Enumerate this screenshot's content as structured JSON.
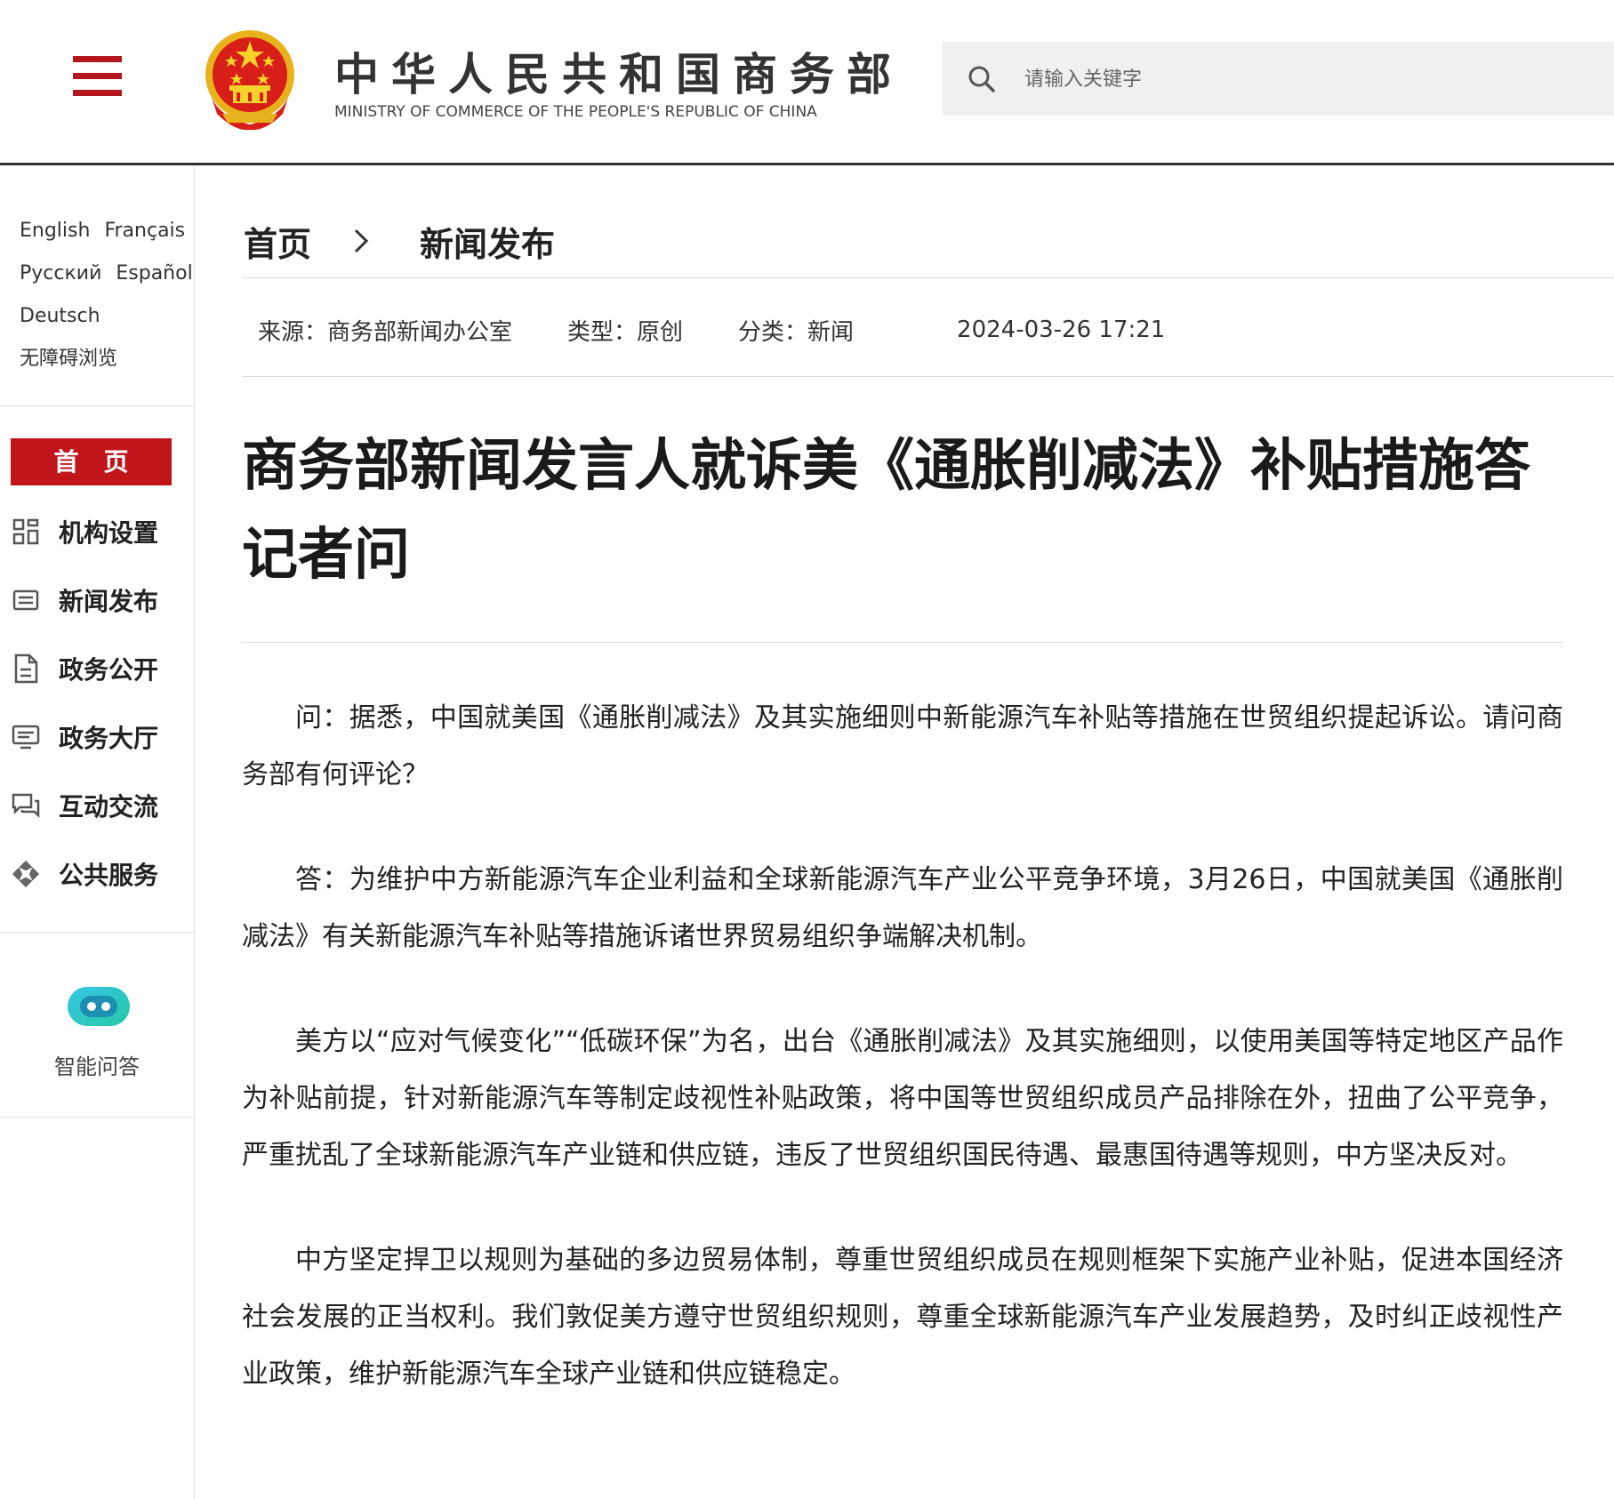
{
  "header": {
    "site_title": "中华人民共和国商务部",
    "site_subtitle": "MINISTRY OF COMMERCE OF THE PEOPLE'S REPUBLIC OF CHINA",
    "search_placeholder": "请输入关键字",
    "accent_color": "#c0151b"
  },
  "sidebar": {
    "languages": [
      "English",
      "Français",
      "Русский",
      "Español",
      "Deutsch"
    ],
    "accessibility": "无障碍浏览",
    "home_label": "首页",
    "nav_items": [
      {
        "label": "机构设置",
        "icon": "grid-icon"
      },
      {
        "label": "新闻发布",
        "icon": "news-icon"
      },
      {
        "label": "政务公开",
        "icon": "document-icon"
      },
      {
        "label": "政务大厅",
        "icon": "monitor-icon"
      },
      {
        "label": "互动交流",
        "icon": "chat-icon"
      },
      {
        "label": "公共服务",
        "icon": "service-icon"
      }
    ],
    "ai_label": "智能问答"
  },
  "breadcrumb": {
    "home": "首页",
    "current": "新闻发布"
  },
  "meta": {
    "source": "来源：商务部新闻办公室",
    "type": "类型：原创",
    "category": "分类：新闻",
    "datetime": "2024-03-26 17:21"
  },
  "article": {
    "title": "商务部新闻发言人就诉美《通胀削减法》补贴措施答记者问",
    "paragraphs": [
      "问：据悉，中国就美国《通胀削减法》及其实施细则中新能源汽车补贴等措施在世贸组织提起诉讼。请问商务部有何评论？",
      "答：为维护中方新能源汽车企业利益和全球新能源汽车产业公平竞争环境，3月26日，中国就美国《通胀削减法》有关新能源汽车补贴等措施诉诸世界贸易组织争端解决机制。",
      "美方以“应对气候变化”“低碳环保”为名，出台《通胀削减法》及其实施细则，以使用美国等特定地区产品作为补贴前提，针对新能源汽车等制定歧视性补贴政策，将中国等世贸组织成员产品排除在外，扭曲了公平竞争，严重扰乱了全球新能源汽车产业链和供应链，违反了世贸组织国民待遇、最惠国待遇等规则，中方坚决反对。",
      "中方坚定捍卫以规则为基础的多边贸易体制，尊重世贸组织成员在规则框架下实施产业补贴，促进本国经济社会发展的正当权利。我们敦促美方遵守世贸组织规则，尊重全球新能源汽车产业发展趋势，及时纠正歧视性产业政策，维护新能源汽车全球产业链和供应链稳定。"
    ]
  }
}
